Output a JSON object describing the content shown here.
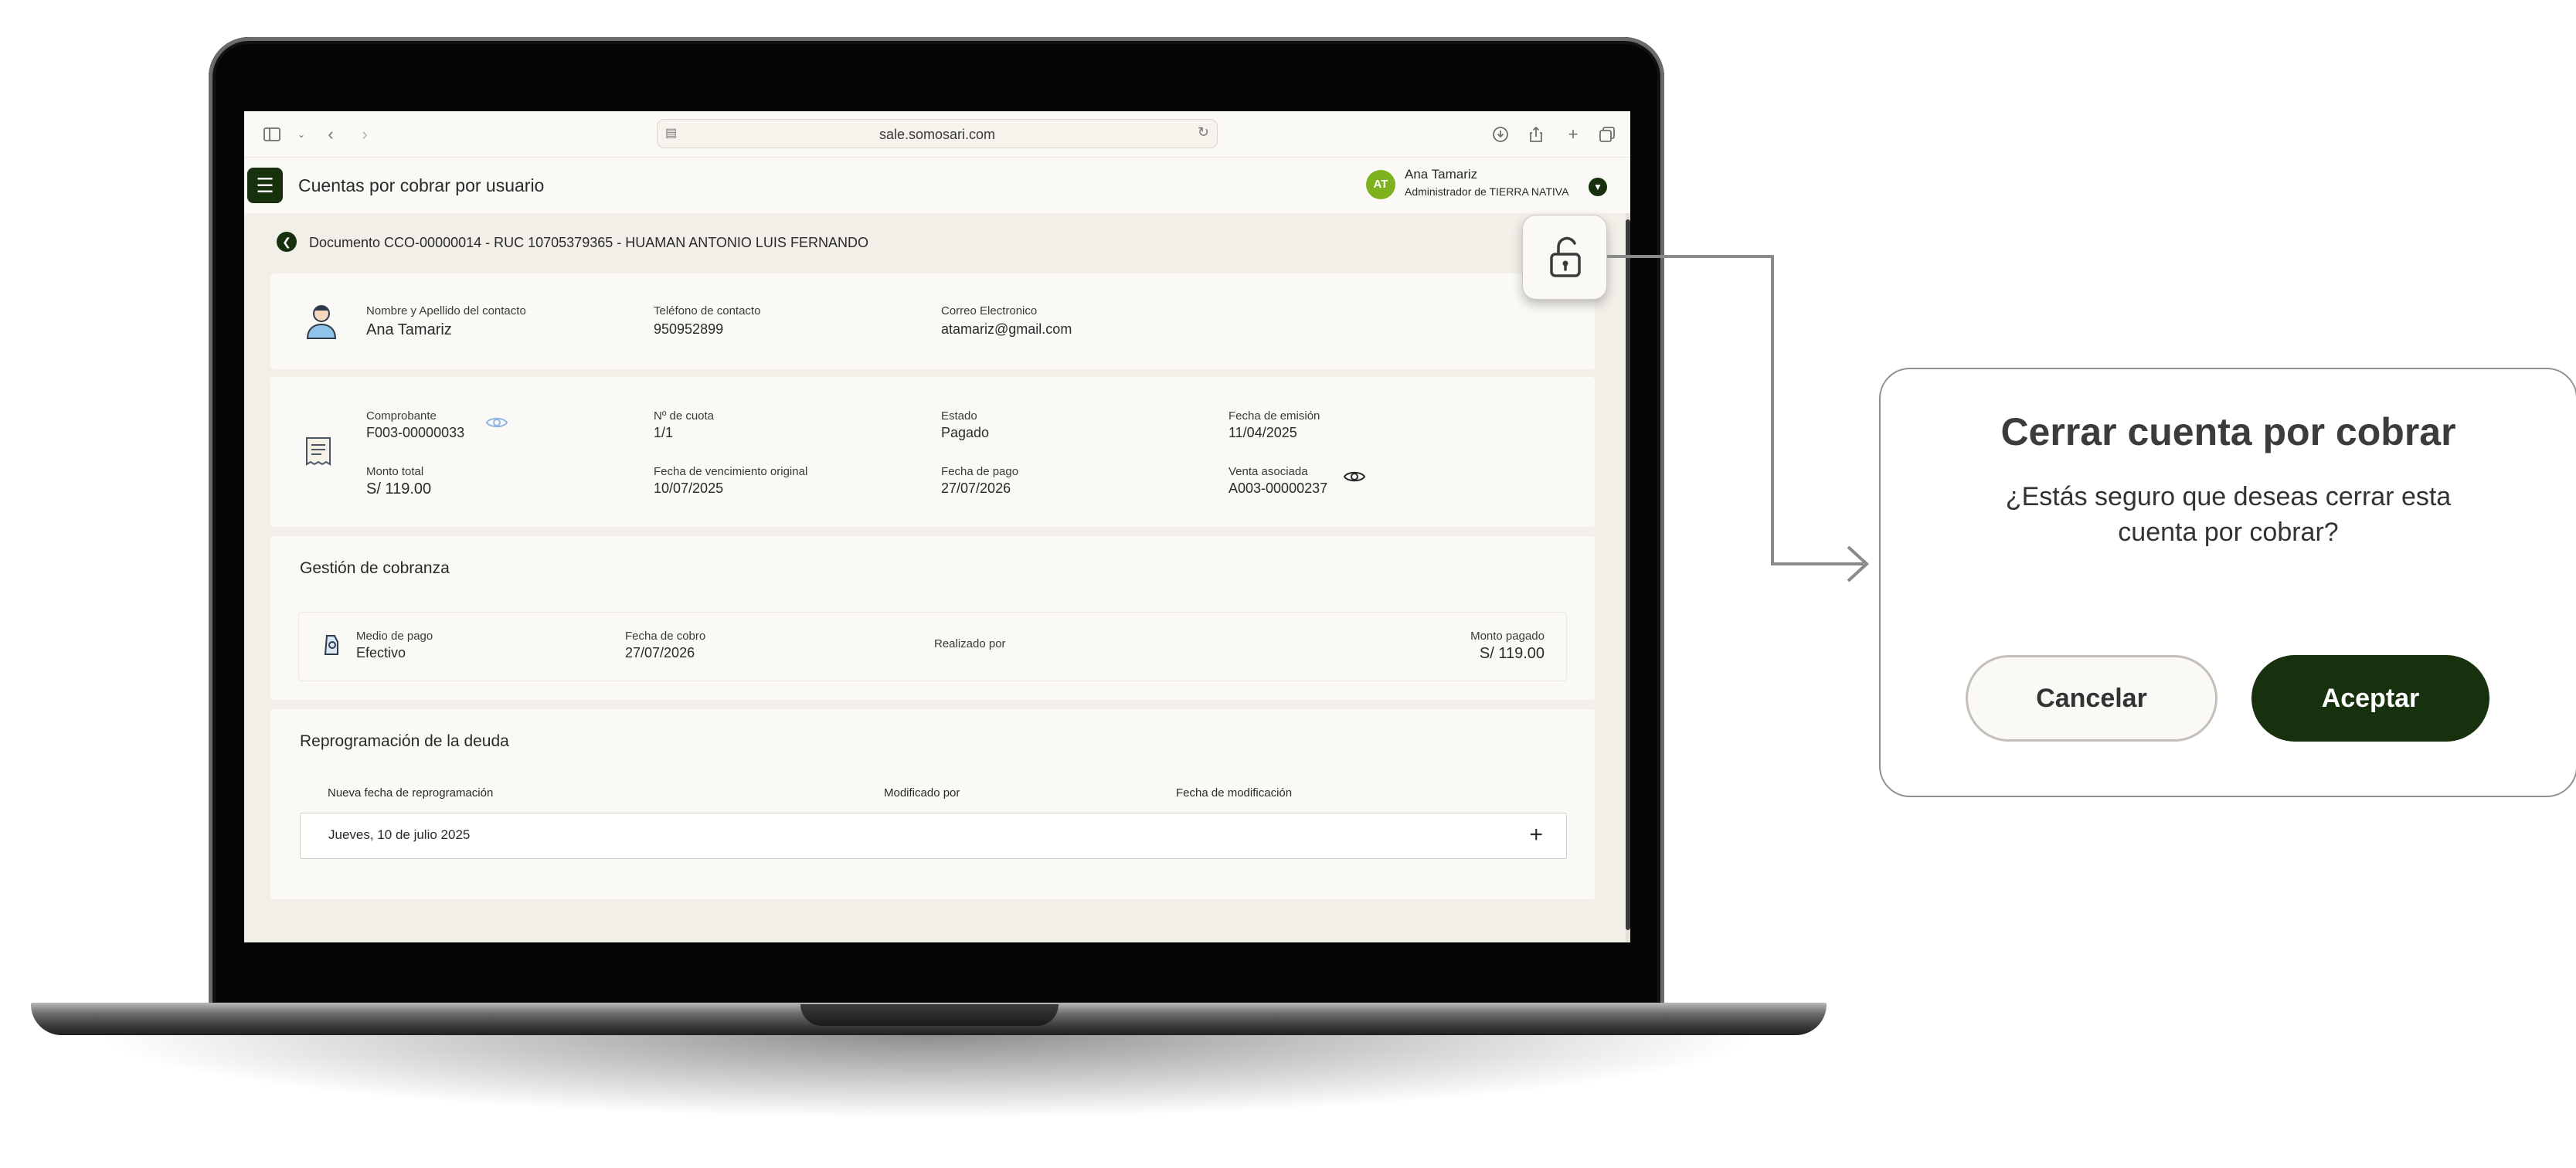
{
  "browser": {
    "url": "sale.somosari.com"
  },
  "header": {
    "title": "Cuentas por cobrar por usuario",
    "user": {
      "initials": "AT",
      "name": "Ana Tamariz",
      "role": "Administrador de TIERRA NATIVA"
    }
  },
  "breadcrumb": {
    "text": "Documento CCO-00000014 - RUC 10705379365 - HUAMAN ANTONIO LUIS FERNANDO"
  },
  "contact": {
    "name_label": "Nombre y Apellido del contacto",
    "name_value": "Ana Tamariz",
    "phone_label": "Teléfono de contacto",
    "phone_value": "950952899",
    "email_label": "Correo Electronico",
    "email_value": "atamariz@gmail.com"
  },
  "document": {
    "comprobante_label": "Comprobante",
    "comprobante_value": "F003-00000033",
    "cuota_label": "Nº de cuota",
    "cuota_value": "1/1",
    "estado_label": "Estado",
    "estado_value": "Pagado",
    "emision_label": "Fecha de emisión",
    "emision_value": "11/04/2025",
    "monto_label": "Monto total",
    "monto_value": "S/ 119.00",
    "vencimiento_label": "Fecha de vencimiento original",
    "vencimiento_value": "10/07/2025",
    "pago_label": "Fecha de pago",
    "pago_value": "27/07/2026",
    "venta_label": "Venta asociada",
    "venta_value": "A003-00000237"
  },
  "cobranza": {
    "title": "Gestión de cobranza",
    "medio_label": "Medio de pago",
    "medio_value": "Efectivo",
    "fecha_label": "Fecha de cobro",
    "fecha_value": "27/07/2026",
    "realizado_label": "Realizado por",
    "monto_label": "Monto pagado",
    "monto_value": "S/ 119.00"
  },
  "reprogramacion": {
    "title": "Reprogramación de la deuda",
    "col_fecha": "Nueva fecha de reprogramación",
    "col_modificado": "Modificado por",
    "col_fecha_mod": "Fecha de modificación",
    "row_fecha": "Jueves, 10 de julio 2025"
  },
  "modal": {
    "title": "Cerrar cuenta por cobrar",
    "body": "¿Estás seguro que deseas cerrar esta cuenta por cobrar?",
    "cancel_label": "Cancelar",
    "accept_label": "Aceptar"
  },
  "colors": {
    "brand_dark_green": "#17300d",
    "avatar_green": "#7db11e",
    "page_bg": "#f2efe9",
    "card_bg": "#fbf9f5"
  },
  "icons": [
    "sidebar-icon",
    "chevron-left-icon",
    "chevron-right-icon",
    "reload-icon",
    "download-icon",
    "share-icon",
    "plus-icon",
    "tabs-icon",
    "menu-icon",
    "user-contact-icon",
    "receipt-icon",
    "eye-icon",
    "payment-hand-icon",
    "unlock-icon",
    "arrow-icon"
  ]
}
